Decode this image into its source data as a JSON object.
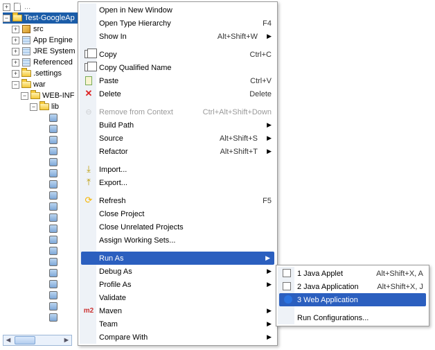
{
  "tree": {
    "selected": "Test-GoogleAp",
    "items": [
      {
        "label": "src"
      },
      {
        "label": "App Engine"
      },
      {
        "label": "JRE System"
      },
      {
        "label": "Referenced"
      },
      {
        "label": ".settings"
      },
      {
        "label": "war"
      },
      {
        "label": "WEB-INF"
      },
      {
        "label": "lib"
      }
    ]
  },
  "menu": {
    "open_new_window": "Open in New Window",
    "open_type_hierarchy": "Open Type Hierarchy",
    "open_type_hierarchy_accel": "F4",
    "show_in": "Show In",
    "show_in_accel": "Alt+Shift+W",
    "copy": "Copy",
    "copy_accel": "Ctrl+C",
    "copy_qualified": "Copy Qualified Name",
    "paste": "Paste",
    "paste_accel": "Ctrl+V",
    "delete": "Delete",
    "delete_accel": "Delete",
    "remove_context": "Remove from Context",
    "remove_context_accel": "Ctrl+Alt+Shift+Down",
    "build_path": "Build Path",
    "source": "Source",
    "source_accel": "Alt+Shift+S",
    "refactor": "Refactor",
    "refactor_accel": "Alt+Shift+T",
    "import": "Import...",
    "export": "Export...",
    "refresh": "Refresh",
    "refresh_accel": "F5",
    "close_project": "Close Project",
    "close_unrelated": "Close Unrelated Projects",
    "assign_ws": "Assign Working Sets...",
    "run_as": "Run As",
    "debug_as": "Debug As",
    "profile_as": "Profile As",
    "validate": "Validate",
    "maven": "Maven",
    "team": "Team",
    "compare_with": "Compare With"
  },
  "submenu": {
    "applet": "1 Java Applet",
    "applet_accel": "Alt+Shift+X, A",
    "javaapp": "2 Java Application",
    "javaapp_accel": "Alt+Shift+X, J",
    "webapp": "3 Web Application",
    "run_config": "Run Configurations..."
  }
}
